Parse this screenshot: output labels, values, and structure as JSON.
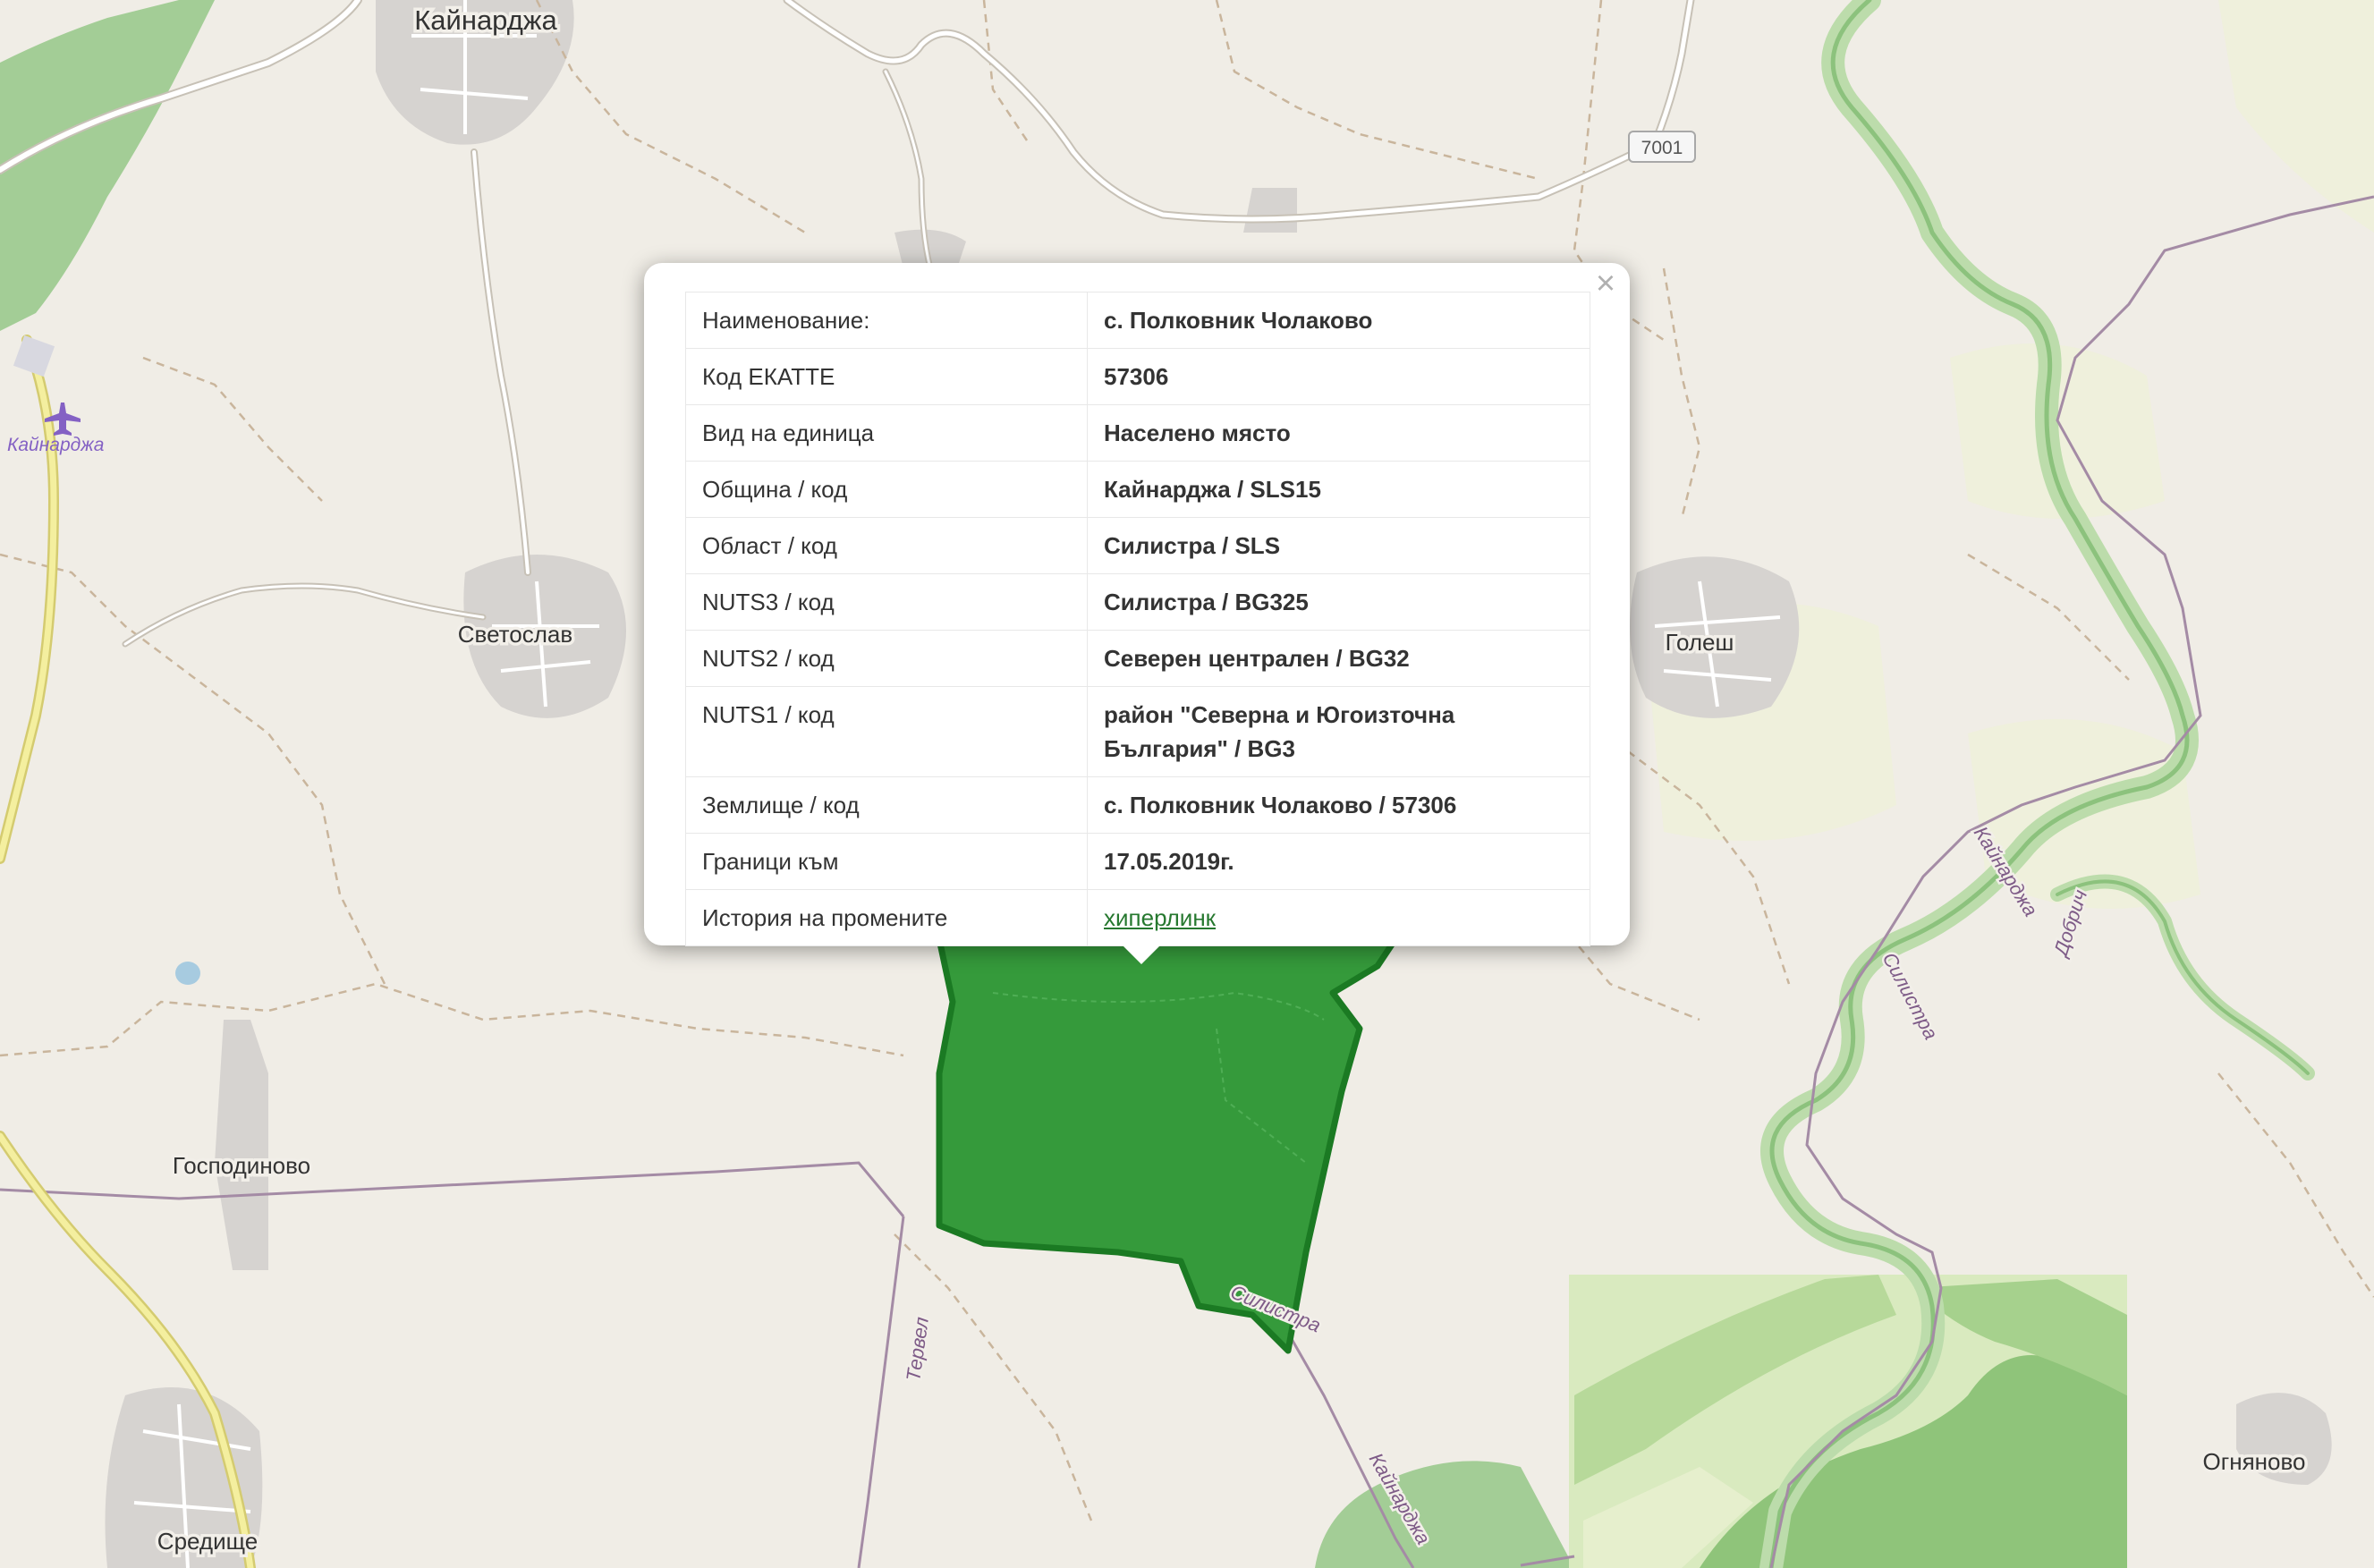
{
  "map": {
    "places": {
      "kaynardzha": "Кайнарджа",
      "svetoslav": "Светослав",
      "golesh": "Голеш",
      "gospodinovo": "Господиново",
      "sredishte": "Средище",
      "ognyanovo": "Огняново"
    },
    "airport_label": "Кайнарджа",
    "road_shield": "7001",
    "labels": {
      "tervel": "Тервел",
      "silistra_boundary": "Силистра",
      "kaynardzha_boundary": "Кайнарджа",
      "kaynardzha_river": "Кайнарджа",
      "silistra_river": "Силистра",
      "dobrich": "Добрич"
    },
    "colors": {
      "background": "#f0ede6",
      "selected_area": "#2a9632",
      "selected_outline": "#1b7a23",
      "forest": "#a3cd96",
      "admin_boundary": "#a48ba5"
    }
  },
  "popup": {
    "close_label": "×",
    "rows": [
      {
        "label": "Наименование:",
        "value": "с. Полковник Чолаково"
      },
      {
        "label": "Код ЕКАТТЕ",
        "value": "57306"
      },
      {
        "label": "Вид на единица",
        "value": "Населено място"
      },
      {
        "label": "Община / код",
        "value": "Кайнарджа / SLS15"
      },
      {
        "label": "Област / код",
        "value": "Силистра / SLS"
      },
      {
        "label": "NUTS3 / код",
        "value": "Силистра / BG325"
      },
      {
        "label": "NUTS2 / код",
        "value": "Северен централен / BG32"
      },
      {
        "label": "NUTS1 / код",
        "value": "район \"Северна и Югоизточна България\" / BG3"
      },
      {
        "label": "Землище / код",
        "value": "с. Полковник Чолаково / 57306"
      },
      {
        "label": "Граници към",
        "value": "17.05.2019г."
      },
      {
        "label": "История на промените",
        "value": "хиперлинк"
      }
    ]
  }
}
